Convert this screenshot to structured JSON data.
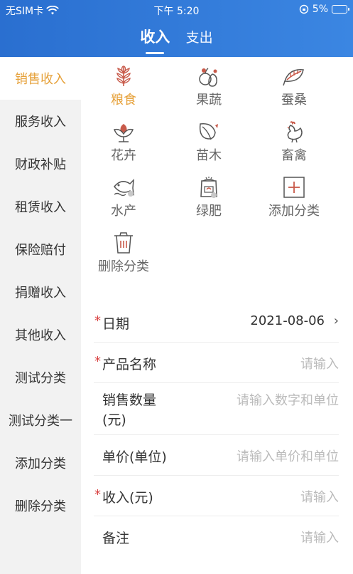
{
  "status": {
    "carrier": "无SIM卡",
    "time": "下午 5:20",
    "battery": "5%"
  },
  "tabs": [
    {
      "label": "收入"
    },
    {
      "label": "支出"
    }
  ],
  "sidebar": {
    "items": [
      {
        "label": "销售收入"
      },
      {
        "label": "服务收入"
      },
      {
        "label": "财政补贴"
      },
      {
        "label": "租赁收入"
      },
      {
        "label": "保险赔付"
      },
      {
        "label": "捐赠收入"
      },
      {
        "label": "其他收入"
      },
      {
        "label": "测试分类"
      },
      {
        "label": "测试分类一"
      },
      {
        "label": "添加分类"
      },
      {
        "label": "删除分类"
      }
    ]
  },
  "categories": [
    {
      "label": "粮食",
      "icon": "grain-icon"
    },
    {
      "label": "果蔬",
      "icon": "fruit-veg-icon"
    },
    {
      "label": "蚕桑",
      "icon": "silkworm-mulberry-icon"
    },
    {
      "label": "花卉",
      "icon": "flower-icon"
    },
    {
      "label": "苗木",
      "icon": "seedling-icon"
    },
    {
      "label": "畜禽",
      "icon": "poultry-icon"
    },
    {
      "label": "水产",
      "icon": "fish-icon"
    },
    {
      "label": "绿肥",
      "icon": "fertilizer-icon"
    },
    {
      "label": "添加分类",
      "icon": "add-category-icon"
    },
    {
      "label": "删除分类",
      "icon": "delete-category-icon"
    }
  ],
  "form": {
    "date": {
      "label": "日期",
      "value": "2021-08-06",
      "required": "*"
    },
    "product": {
      "label": "产品名称",
      "placeholder": "请输入",
      "required": "*"
    },
    "quantity": {
      "label_line1": "销售数量",
      "label_line2": "(元)",
      "placeholder": "请输入数字和单位"
    },
    "price": {
      "label": "单价(单位)",
      "placeholder": "请输入单价和单位"
    },
    "income": {
      "label": "收入(元)",
      "placeholder": "请输入",
      "required": "*"
    },
    "note": {
      "label": "备注",
      "placeholder": "请输入"
    }
  },
  "colors": {
    "header": "#3b86e2",
    "accent": "#e6a13a",
    "required": "#d94141"
  }
}
